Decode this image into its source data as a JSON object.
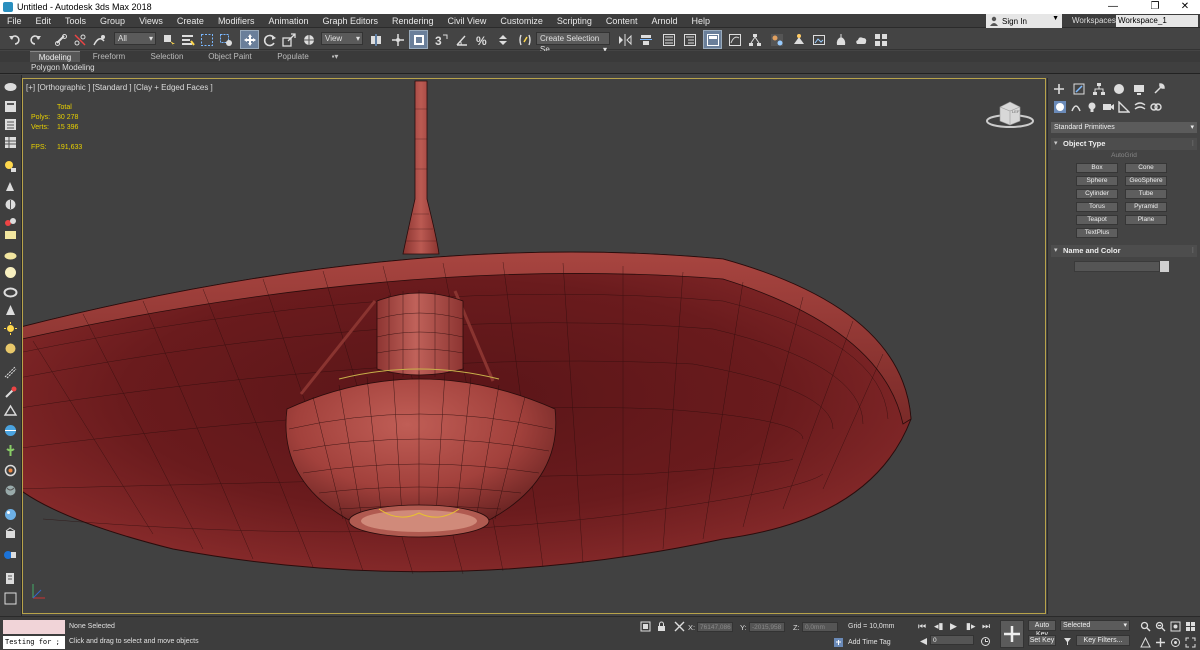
{
  "window": {
    "title": "Untitled - Autodesk 3ds Max 2018",
    "minimize": "—",
    "restore": "❐",
    "close": "✕"
  },
  "menu": [
    "File",
    "Edit",
    "Tools",
    "Group",
    "Views",
    "Create",
    "Modifiers",
    "Animation",
    "Graph Editors",
    "Rendering",
    "Civil View",
    "Customize",
    "Scripting",
    "Content",
    "Arnold",
    "Help"
  ],
  "account": {
    "signin": "Sign In",
    "workspaces_label": "Workspaces:",
    "workspace": "Workspace_1"
  },
  "toolbar": {
    "filter": "All",
    "refcoord": "View",
    "selection_set": "Create Selection Se"
  },
  "ribbon": {
    "tabs": [
      "Modeling",
      "Freeform",
      "Selection",
      "Object Paint",
      "Populate"
    ],
    "subtitle": "Polygon Modeling"
  },
  "viewport": {
    "label": "[+] [Orthographic ] [Standard ] [Clay + Edged Faces ]",
    "stats": {
      "header": "Total",
      "polys_label": "Polys:",
      "polys": "30 278",
      "verts_label": "Verts:",
      "verts": "15 396",
      "fps_label": "FPS:",
      "fps": "191,633"
    },
    "viewcube": "LEFT"
  },
  "command_panel": {
    "category": "Standard Primitives",
    "object_type_title": "Object Type",
    "autogrid": "AutoGrid",
    "buttons": [
      "Box",
      "Cone",
      "Sphere",
      "GeoSphere",
      "Cylinder",
      "Tube",
      "Torus",
      "Pyramid",
      "Teapot",
      "Plane",
      "TextPlus"
    ],
    "name_color_title": "Name and Color"
  },
  "status": {
    "selected": "None Selected",
    "prompt": "Click and drag to select and move objects",
    "maxscript": "Testing for ;",
    "x_label": "X:",
    "x": "76147,086",
    "y_label": "Y:",
    "y": "-2015,958",
    "z_label": "Z:",
    "z": "0,0mm",
    "grid": "Grid = 10,0mm",
    "add_time_tag": "Add Time Tag",
    "frame": "0",
    "auto_key": "Auto Key",
    "set_key": "Set Key",
    "key_mode": "Selected",
    "key_filters": "Key Filters..."
  }
}
